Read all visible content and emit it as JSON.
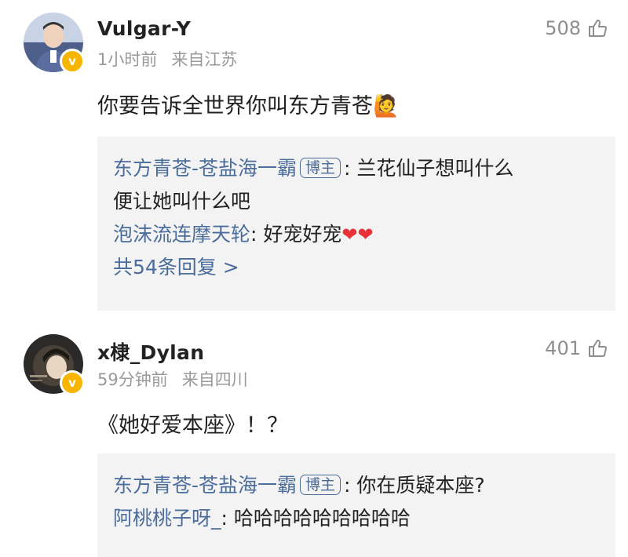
{
  "comments": [
    {
      "username": "Vulgar-Y",
      "time": "1小时前",
      "location": "来自江苏",
      "likes": "508",
      "text": "你要告诉全世界你叫东方青苍",
      "emoji": "🙋",
      "replies": [
        {
          "name": "东方青苍-苍盐海一霸",
          "tag": "博主",
          "text": ": 兰花仙子想叫什么",
          "text2": "便让她叫什么吧"
        },
        {
          "name": "泡沫流连摩天轮",
          "text": ": 好宠好宠",
          "hearts": "❤❤"
        }
      ],
      "more": "共54条回复 >"
    },
    {
      "username": "x棣_Dylan",
      "time": "59分钟前",
      "location": "来自四川",
      "likes": "401",
      "text": "《她好爱本座》！？",
      "replies": [
        {
          "name": "东方青苍-苍盐海一霸",
          "tag": "博主",
          "text": ": 你在质疑本座?"
        },
        {
          "name": "阿桃桃子呀_",
          "text": ": 哈哈哈哈哈哈哈哈哈"
        }
      ]
    }
  ],
  "colors": {
    "link": "#4b6d9b",
    "badge": "#f7b500",
    "heart": "#e8323a"
  }
}
